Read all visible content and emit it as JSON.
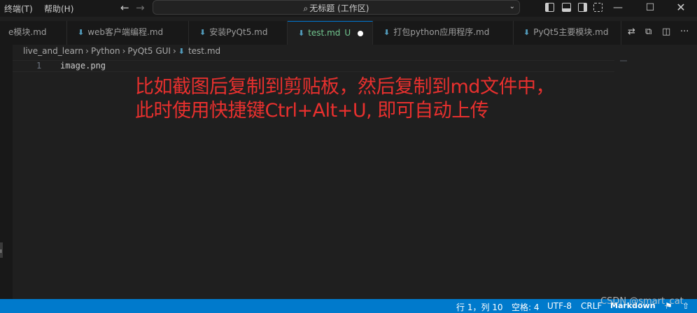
{
  "menu": {
    "terminal": "终端(T)",
    "help": "帮助(H)"
  },
  "nav": {
    "back": "←",
    "forward": "→"
  },
  "search": {
    "icon": "⌕",
    "text": "无标题 (工作区)",
    "chevron": "⌄"
  },
  "window": {
    "minimize": "—",
    "maximize": "☐",
    "close": "✕"
  },
  "tabs": [
    {
      "icon": "⬇",
      "label": "e模块.md"
    },
    {
      "icon": "⬇",
      "label": "web客户端编程.md"
    },
    {
      "icon": "⬇",
      "label": "安装PyQt5.md"
    },
    {
      "icon": "⬇",
      "label": "test.md",
      "status": "U",
      "active": true
    },
    {
      "icon": "⬇",
      "label": "打包python应用程序.md"
    },
    {
      "icon": "⬇",
      "label": "PyQt5主要模块.md"
    }
  ],
  "tab_actions": {
    "compare": "⇄",
    "preview": "⧉",
    "split": "◫",
    "more": "···"
  },
  "breadcrumb": {
    "items": [
      "live_and_learn",
      "Python",
      "PyQt5 GUI",
      "test.md"
    ],
    "separator": "›",
    "file_icon": "⬇"
  },
  "editor": {
    "line_number": "1",
    "line_text": "image.png",
    "annotation_line1": "比如截图后复制到剪贴板，然后复制到md文件中，",
    "annotation_line2": "此时使用快捷键Ctrl+Alt+U, 即可自动上传"
  },
  "activity": {
    "marker": "ı"
  },
  "status": {
    "position": "行 1，列 10",
    "spaces": "空格: 4",
    "encoding": "UTF-8",
    "eol": "CRLF",
    "language": "Markdown",
    "feedback_icon": "⚑",
    "notification_icon": "⇧"
  },
  "watermark": "CSDN @smart_cat",
  "colors": {
    "status_bar": "#007acc",
    "accent": "#0078d4",
    "annotation": "#e8302e",
    "md_icon": "#519aba",
    "untracked": "#73c991"
  }
}
